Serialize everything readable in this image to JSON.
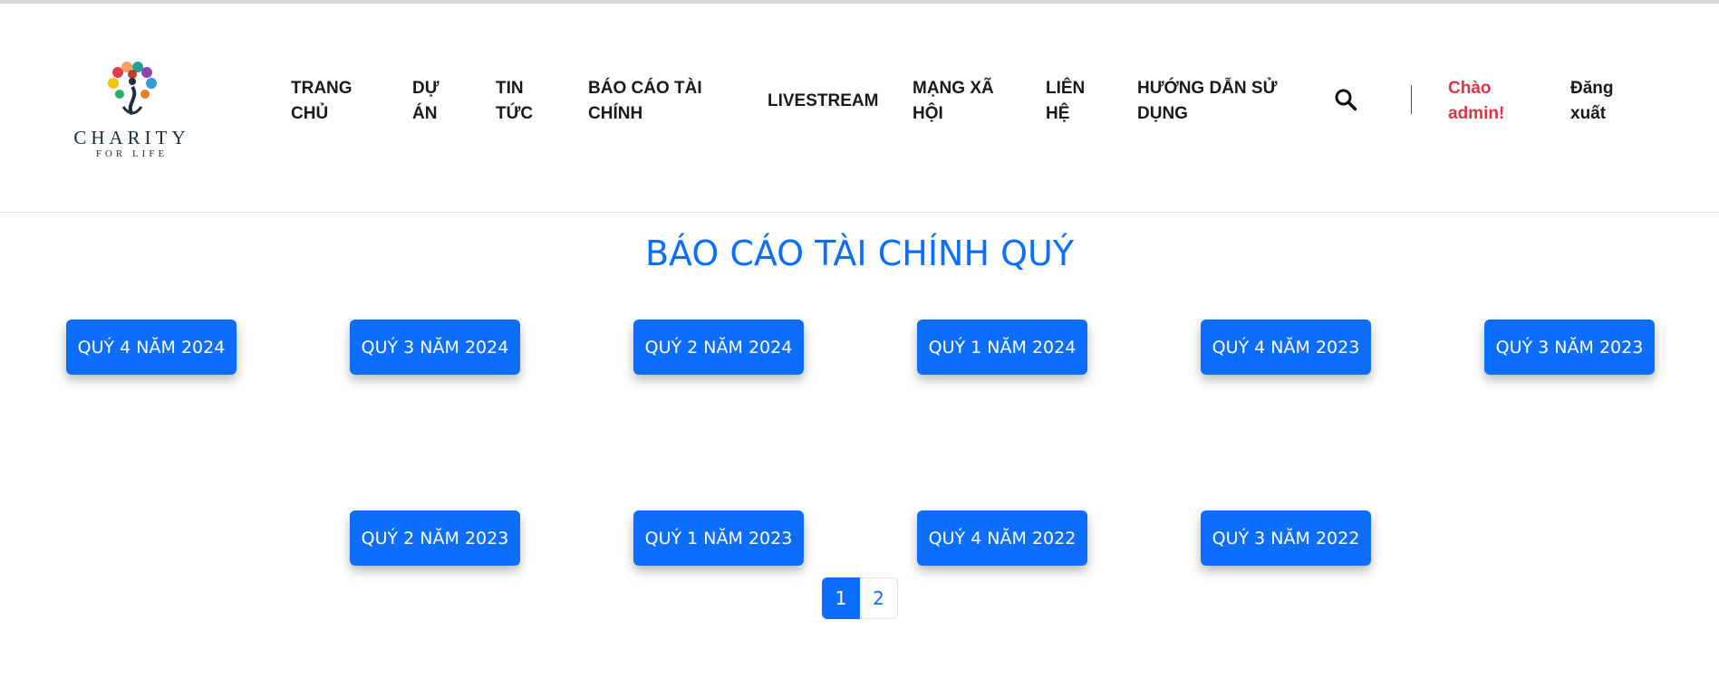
{
  "logo": {
    "brand": "CHARITY",
    "tagline": "FOR LIFE"
  },
  "nav": {
    "items": [
      {
        "label": "TRANG CHỦ"
      },
      {
        "label": "DỰ ÁN"
      },
      {
        "label": "TIN TỨC"
      },
      {
        "label": "BÁO CÁO TÀI CHÍNH"
      },
      {
        "label": "LIVESTREAM"
      },
      {
        "label": "MẠNG XÃ HỘI"
      },
      {
        "label": "LIÊN HỆ"
      },
      {
        "label": "HƯỚNG DẪN SỬ DỤNG"
      }
    ],
    "search_icon": "search-icon",
    "greeting": "Chào admin!",
    "logout": "Đăng xuất"
  },
  "page": {
    "title": "BÁO CÁO TÀI CHÍNH QUÝ"
  },
  "reports": [
    {
      "label": "QUÝ 4 NĂM 2024"
    },
    {
      "label": "QUÝ 3 NĂM 2024"
    },
    {
      "label": "QUÝ 2 NĂM 2024"
    },
    {
      "label": "QUÝ 1 NĂM 2024"
    },
    {
      "label": "QUÝ 4 NĂM 2023"
    },
    {
      "label": "QUÝ 3 NĂM 2023"
    },
    {
      "label": "QUÝ 2 NĂM 2023"
    },
    {
      "label": "QUÝ 1 NĂM 2023"
    },
    {
      "label": "QUÝ 4 NĂM 2022"
    },
    {
      "label": "QUÝ 3 NĂM 2022"
    }
  ],
  "pagination": {
    "pages": [
      {
        "label": "1",
        "active": true
      },
      {
        "label": "2",
        "active": false
      }
    ]
  },
  "colors": {
    "primary": "#0d6efd",
    "greeting": "#dc3545",
    "text": "#1a1a1a"
  }
}
